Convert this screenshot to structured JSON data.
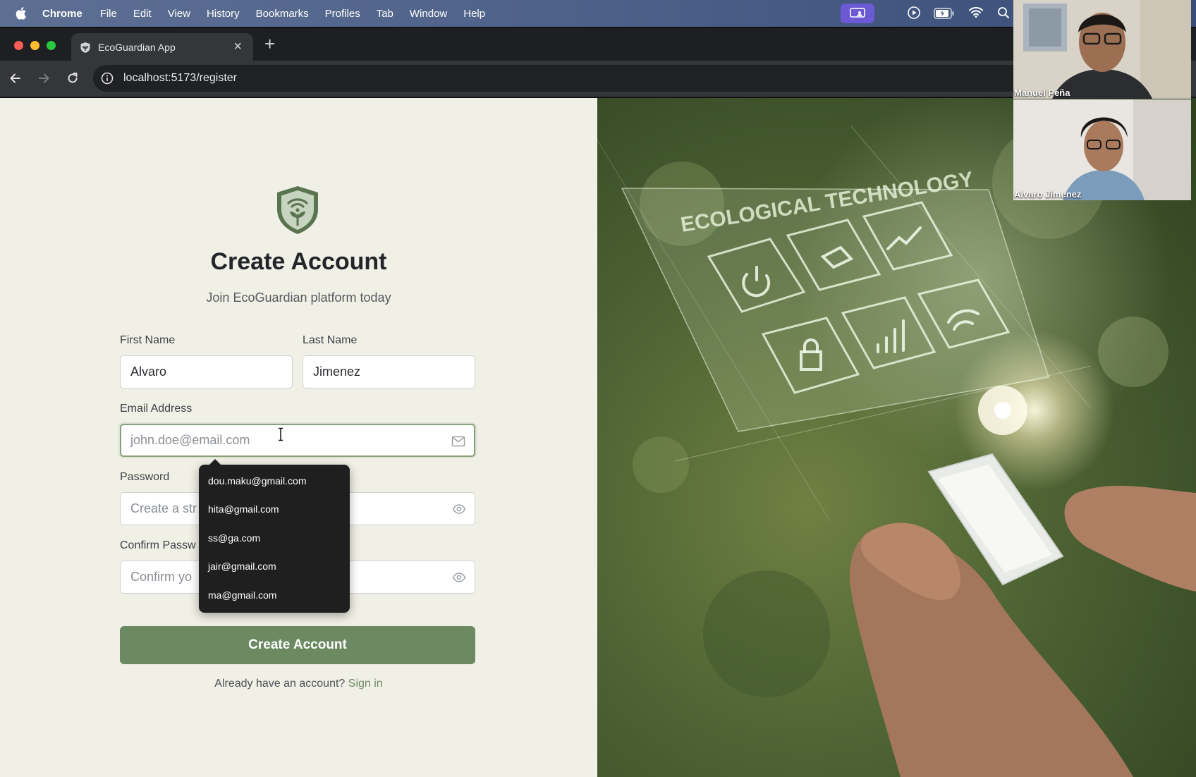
{
  "menubar": {
    "app_name": "Chrome",
    "items": [
      "File",
      "Edit",
      "View",
      "History",
      "Bookmarks",
      "Profiles",
      "Tab",
      "Window",
      "Help"
    ],
    "accent_color": "#6c5ad4"
  },
  "browser": {
    "tab_title": "EcoGuardian App",
    "url": "localhost:5173/register"
  },
  "form": {
    "title": "Create Account",
    "subtitle": "Join EcoGuardian platform today",
    "first_name": {
      "label": "First Name",
      "value": "Alvaro"
    },
    "last_name": {
      "label": "Last Name",
      "value": "Jimenez"
    },
    "email": {
      "label": "Email Address",
      "placeholder": "john.doe@email.com"
    },
    "password": {
      "label": "Password",
      "placeholder": "Create a str"
    },
    "confirm_password": {
      "label": "Confirm Passw",
      "placeholder": "Confirm yo"
    },
    "submit_label": "Create Account",
    "signin_prompt": "Already have an account?",
    "signin_link": "Sign in",
    "brand_color": "#6b8a62"
  },
  "autocomplete": {
    "suggestions": [
      "dou.maku@gmail.com",
      "hita@gmail.com",
      "ss@ga.com",
      "jair@gmail.com",
      "ma@gmail.com"
    ]
  },
  "hero": {
    "caption": "ECOLOGICAL TECHNOLOGY",
    "icons": [
      "power-icon",
      "drone-icon",
      "chart-icon",
      "lock-icon",
      "signal-bars-icon",
      "wifi-icon"
    ]
  },
  "video_call": {
    "participants": [
      {
        "name": "Manuel Peña"
      },
      {
        "name": "Alvaro Jimenez"
      }
    ]
  }
}
